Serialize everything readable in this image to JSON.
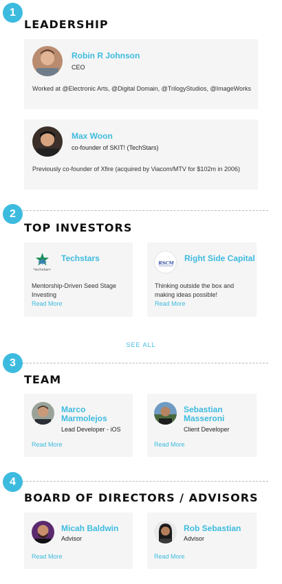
{
  "sections": {
    "leadership": {
      "step": "1",
      "title": "LEADERSHIP"
    },
    "investors": {
      "step": "2",
      "title": "TOP INVESTORS"
    },
    "team": {
      "step": "3",
      "title": "TEAM"
    },
    "board": {
      "step": "4",
      "title": "BOARD OF DIRECTORS / ADVISORS"
    }
  },
  "leaders": [
    {
      "name": "Robin R Johnson",
      "role": "CEO",
      "desc": "Worked at @Electronic Arts, @Digital Domain, @TrilogyStudios, @ImageWorks"
    },
    {
      "name": "Max Woon",
      "role": "co-founder of SKIT! (TechStars)",
      "desc": "Previously co-founder of Xfire (acquired by Viacom/MTV for $102m in 2006)"
    }
  ],
  "investors": [
    {
      "name": "Techstars",
      "logo_text": "techstars",
      "desc": "Mentorship-Driven Seed Stage Investing",
      "more": "Read More"
    },
    {
      "name": "Right Side Capital",
      "logo_text": "RSCM",
      "desc": "Thinking outside the box and making ideas possible!",
      "more": "Read More"
    }
  ],
  "see_all": "SEE ALL",
  "team": [
    {
      "name": "Marco Marmolejos",
      "role": "Lead Developer - iOS",
      "more": "Read More"
    },
    {
      "name": "Sebastian Masseroni",
      "role": "Client Developer",
      "more": "Read More"
    }
  ],
  "board": [
    {
      "name": "Micah Baldwin",
      "role": "Advisor",
      "more": "Read More"
    },
    {
      "name": "Rob Sebastian",
      "role": "Advisor",
      "more": "Read More"
    }
  ],
  "colors": {
    "accent": "#3dbbdf",
    "card": "#f5f5f5"
  }
}
